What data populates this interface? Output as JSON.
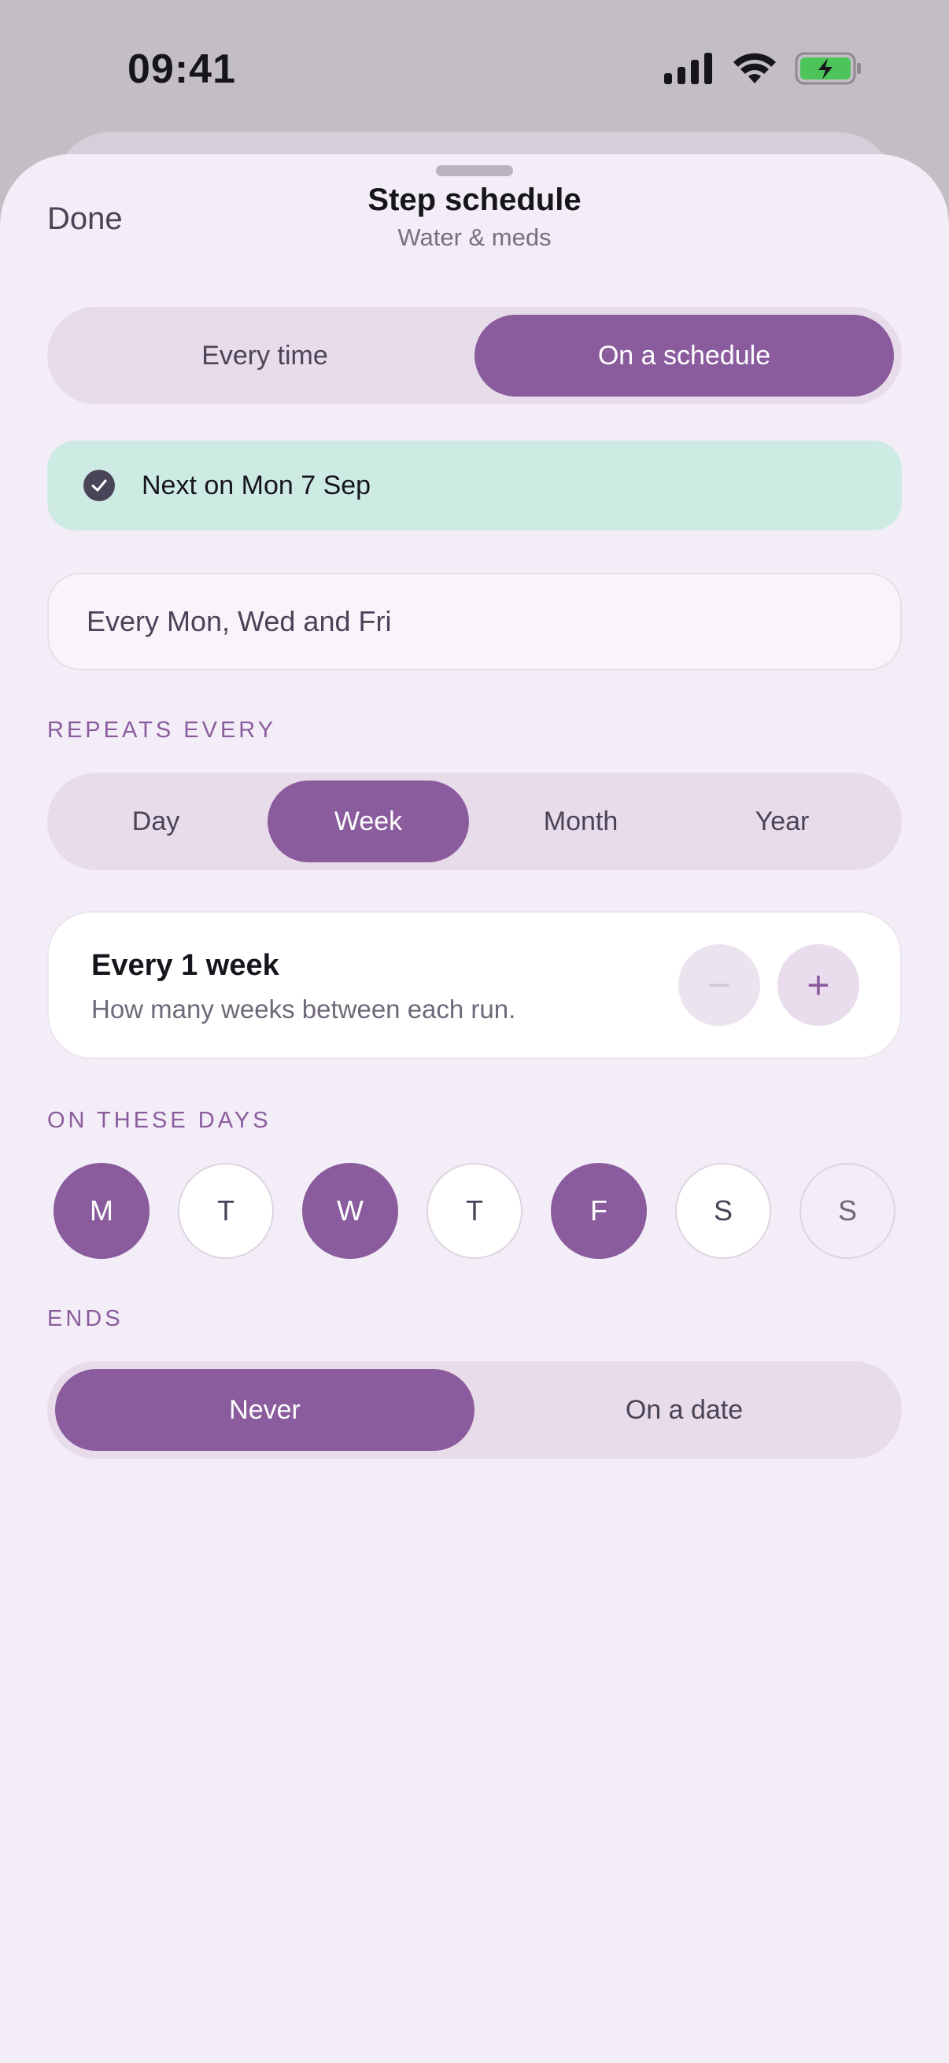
{
  "status_bar": {
    "time": "09:41"
  },
  "header": {
    "done_label": "Done",
    "title": "Step schedule",
    "subtitle": "Water & meds"
  },
  "mode_toggle": {
    "options": [
      "Every time",
      "On a schedule"
    ],
    "selected": "On a schedule"
  },
  "next_run": {
    "text": "Next on Mon 7 Sep"
  },
  "summary": {
    "text": "Every Mon, Wed and Fri"
  },
  "repeats": {
    "label": "REPEATS EVERY",
    "options": [
      "Day",
      "Week",
      "Month",
      "Year"
    ],
    "selected": "Week"
  },
  "interval": {
    "title": "Every 1 week",
    "description": "How many weeks between each run.",
    "minus_symbol": "−",
    "plus_symbol": "+"
  },
  "days": {
    "label": "ON THESE DAYS",
    "items": [
      {
        "letter": "M",
        "selected": true
      },
      {
        "letter": "T",
        "selected": false
      },
      {
        "letter": "W",
        "selected": true
      },
      {
        "letter": "T",
        "selected": false
      },
      {
        "letter": "F",
        "selected": true
      },
      {
        "letter": "S",
        "selected": false
      },
      {
        "letter": "S",
        "selected": false
      }
    ]
  },
  "ends": {
    "label": "ENDS",
    "options": [
      "Never",
      "On a date"
    ],
    "selected": "Never"
  },
  "colors": {
    "accent": "#8a5c9d",
    "banner": "#cdebe3",
    "sheet": "#f3edf7"
  }
}
